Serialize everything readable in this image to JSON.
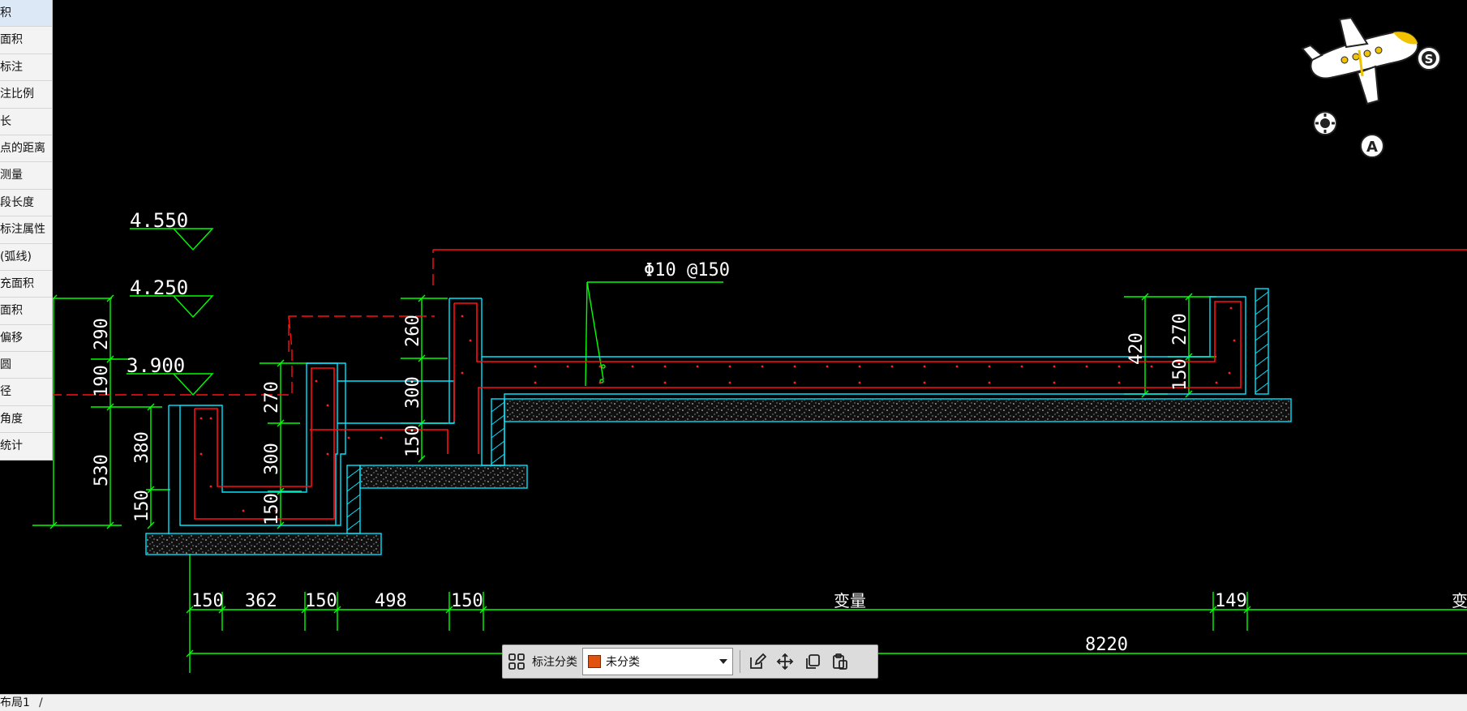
{
  "side_menu": {
    "items": [
      "积",
      "面积",
      "标注",
      "注比例",
      "长",
      "点的距离",
      "测量",
      "段长度",
      "标注属性",
      "(弧线)",
      "充面积",
      "面积",
      "偏移",
      "圆",
      "径",
      "角度",
      "统计"
    ]
  },
  "drawing": {
    "elevations": [
      "4.550",
      "4.250",
      "3.900"
    ],
    "rebar_label": "Φ10 @150",
    "dims_left": [
      "290",
      "190",
      "530",
      "380",
      "150"
    ],
    "dims_mid_a": [
      "270",
      "300",
      "150"
    ],
    "dims_mid_b": [
      "260",
      "300",
      "150"
    ],
    "dims_right_a": [
      "420"
    ],
    "dims_right_b": [
      "270",
      "150"
    ],
    "dims_bottom": [
      "150",
      "362",
      "150",
      "498",
      "150",
      "变量",
      "149",
      "变"
    ],
    "dim_total": "8220"
  },
  "toolbar": {
    "category_label": "标注分类",
    "category_value": "未分类",
    "swatch_color": "#e0520e"
  },
  "view_widget": {
    "letter_s": "S",
    "letter_a": "A"
  },
  "tabs": {
    "layout_tab": "布局1",
    "separator": "/"
  },
  "colors": {
    "background": "#000000",
    "dimension": "#00ff00",
    "rebar": "#ff1010",
    "outline": "#00e5ff",
    "text": "#ffffff"
  }
}
